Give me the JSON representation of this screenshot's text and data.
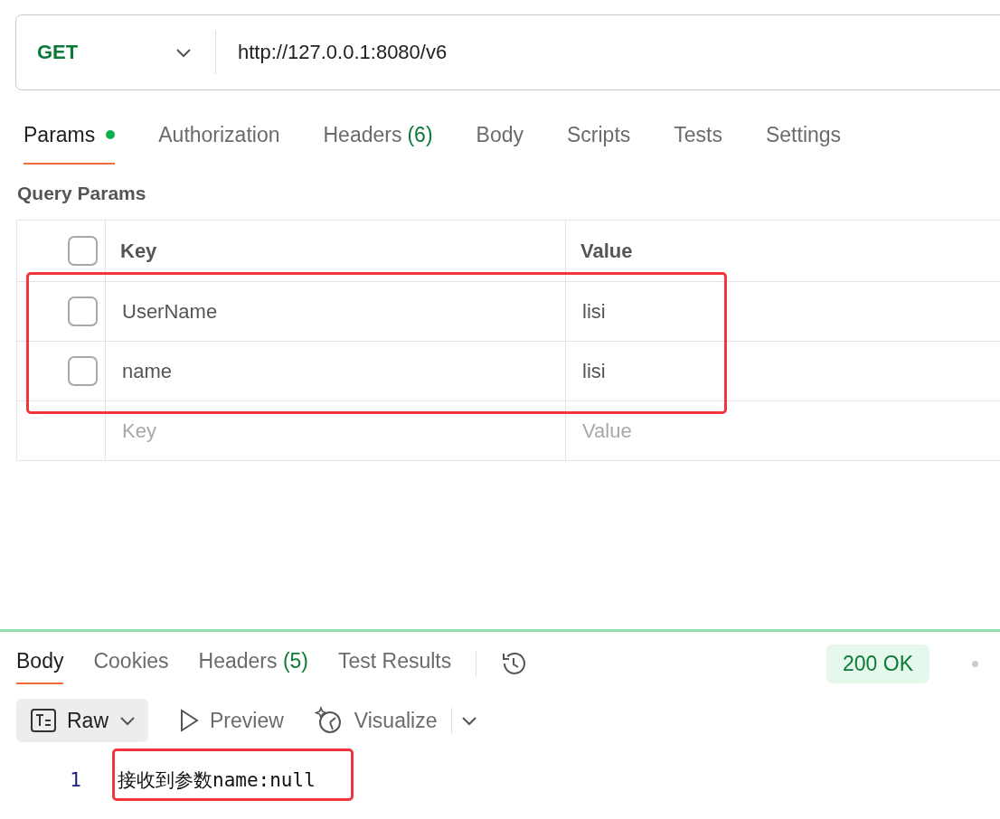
{
  "request": {
    "method": "GET",
    "url": "http://127.0.0.1:8080/v6"
  },
  "request_tabs": [
    {
      "label": "Params",
      "dot": true,
      "selected": true
    },
    {
      "label": "Authorization",
      "dot": false,
      "selected": false
    },
    {
      "label": "Headers",
      "count": "(6)",
      "dot": false,
      "selected": false
    },
    {
      "label": "Body",
      "dot": false,
      "selected": false
    },
    {
      "label": "Scripts",
      "dot": false,
      "selected": false
    },
    {
      "label": "Tests",
      "dot": false,
      "selected": false
    },
    {
      "label": "Settings",
      "dot": false,
      "selected": false
    }
  ],
  "query_params": {
    "title": "Query Params",
    "columns": [
      "Key",
      "Value"
    ],
    "header_checked": false,
    "rows": [
      {
        "key": "UserName",
        "value": "lisi",
        "checked": false
      },
      {
        "key": "name",
        "value": "lisi",
        "checked": false
      }
    ],
    "new_row": {
      "key_placeholder": "Key",
      "value_placeholder": "Value"
    }
  },
  "response_tabs": [
    {
      "label": "Body",
      "selected": true
    },
    {
      "label": "Cookies",
      "selected": false
    },
    {
      "label": "Headers",
      "count": "(5)",
      "selected": false
    },
    {
      "label": "Test Results",
      "selected": false
    }
  ],
  "status": "200 OK",
  "body_toolbar": {
    "format": "Raw",
    "preview": "Preview",
    "visualize": "Visualize"
  },
  "lines": [
    {
      "number": "1",
      "text": "接收到参数name:null"
    }
  ]
}
